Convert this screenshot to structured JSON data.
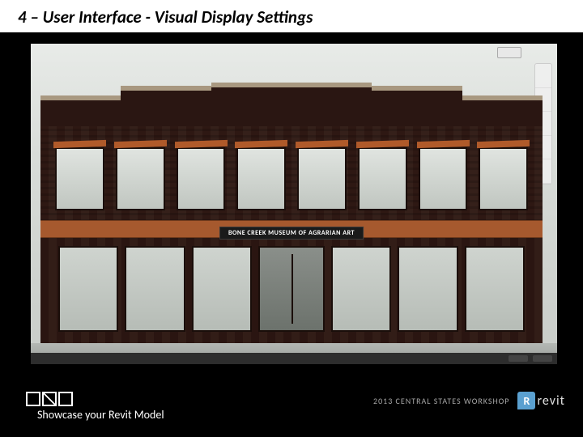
{
  "slide": {
    "title": "4 – User Interface   - Visual Display Settings",
    "caption": "Showcase your Revit Model"
  },
  "building": {
    "sign": "BONE CREEK MUSEUM OF AGRARIAN ART"
  },
  "footer": {
    "workshop": "2013 CENTRAL STATES WORKSHOP",
    "brand": "revit",
    "brand_initial": "R"
  }
}
